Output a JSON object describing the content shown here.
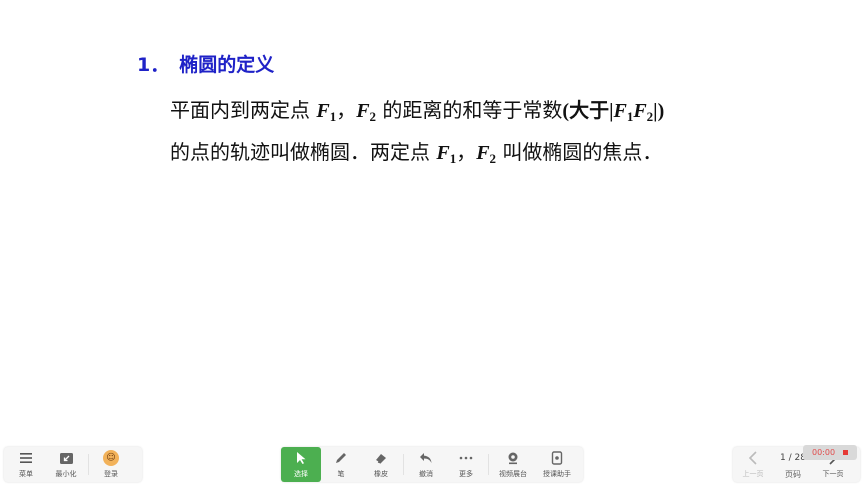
{
  "slide": {
    "heading_num": "1．",
    "heading_text": "椭圆的定义",
    "line1": {
      "t1": "平面内到两定点 ",
      "f1": "F",
      "f1_sub": "1",
      "comma": "，",
      "f2": "F",
      "f2_sub": "2",
      "t2": " 的距离的和等于常数",
      "paren": "(大于|",
      "f3": "F",
      "f3_sub": "1",
      "f4": "F",
      "f4_sub": "2",
      "close": "|)"
    },
    "line2": {
      "t1": "的点的轨迹叫做椭圆．两定点 ",
      "f1": "F",
      "f1_sub": "1",
      "comma": "，",
      "f2": "F",
      "f2_sub": "2",
      "t2": " 叫做椭圆的焦点．"
    }
  },
  "toolbar_left": {
    "menu": "菜单",
    "minimize": "最小化",
    "login": "登录"
  },
  "toolbar_center": {
    "select": "选择",
    "pen": "笔",
    "eraser": "橡皮",
    "undo": "撤消",
    "more": "更多",
    "video_booth": "视频展台",
    "teaching_assistant": "授课助手"
  },
  "toolbar_right": {
    "prev": "上一页",
    "page_indicator": "1 / 28",
    "page_label": "页码",
    "next": "下一页"
  },
  "recorder": {
    "time": "00:00"
  },
  "colors": {
    "heading": "#1f22c7",
    "active_tool": "#4caf50",
    "record": "#e53935"
  }
}
